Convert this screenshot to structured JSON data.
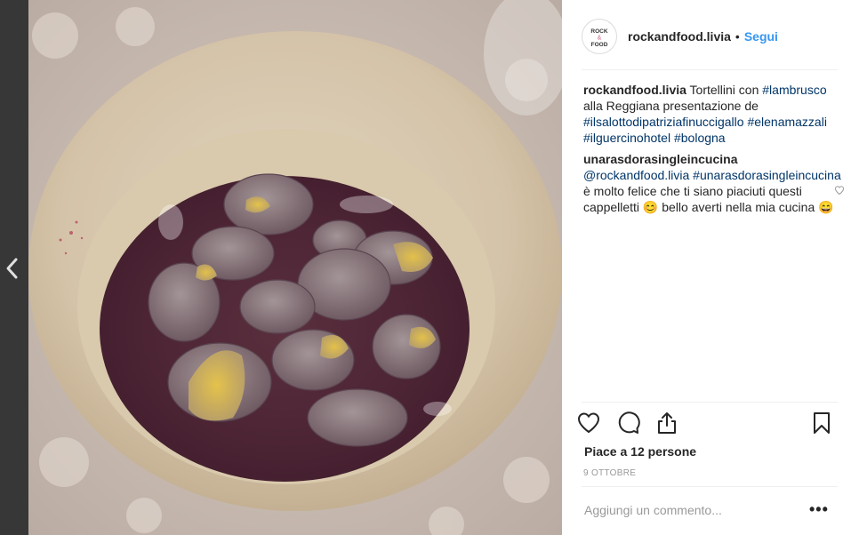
{
  "post": {
    "username": "rockandfood.livia",
    "follow_label": "Segui",
    "dot": "•",
    "avatar_text_top": "ROCK",
    "avatar_text_bottom": "FOOD",
    "avatar_amp": "&"
  },
  "caption": {
    "user": "rockandfood.livia",
    "text1": " Tortellini con ",
    "tag1": "#lambrusco",
    "text2": " alla Reggiana presentazione de ",
    "tag2": "#ilsalottodipatriziafinuccigallo",
    "tag3": "#elenamazzali",
    "tag4": "#ilguercinohotel",
    "tag5": "#bologna"
  },
  "reply": {
    "user": "unarasdorasingleincucina",
    "mention": "@rockandfood.livia",
    "tag": "#unarasdorasingleincucina",
    "text": " è molto felice che ti siano piaciuti questi cappelletti 😊 bello averti nella mia cucina 😄"
  },
  "likes_label": "Piace a 12 persone",
  "date_label": "9 OTTOBRE",
  "add_comment_placeholder": "Aggiungi un commento...",
  "more_label": "•••",
  "icons": [
    "chevron-left-icon",
    "heart-icon",
    "comment-icon",
    "share-icon",
    "bookmark-icon",
    "heart-small-icon"
  ],
  "colors": {
    "link": "#3897f0",
    "hashtag": "#003569",
    "text": "#262626",
    "muted": "#999999"
  }
}
